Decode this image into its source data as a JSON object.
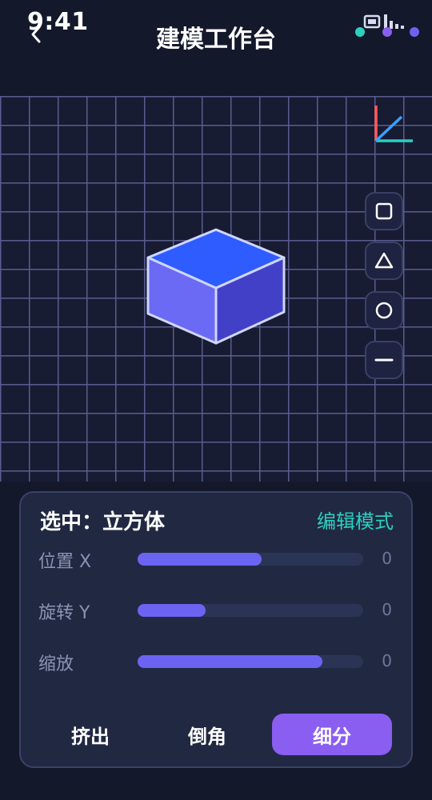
{
  "status_bar": {
    "time": "9:41"
  },
  "header": {
    "title": "建模工作台"
  },
  "panel": {
    "selection_label": "选中：立方体",
    "mode_label": "编辑模式",
    "params": [
      {
        "label": "位置 X",
        "value": "0",
        "level": 0.55
      },
      {
        "label": "旋转 Y",
        "value": "0",
        "level": 0.3
      },
      {
        "label": "缩放",
        "value": "0",
        "level": 0.82
      }
    ],
    "actions": [
      {
        "label": "挤出",
        "active": false
      },
      {
        "label": "倒角",
        "active": false
      },
      {
        "label": "细分",
        "active": true
      }
    ]
  },
  "tools": [
    {
      "icon": "square-icon"
    },
    {
      "icon": "triangle-icon"
    },
    {
      "icon": "circle-icon"
    },
    {
      "icon": "minus-icon"
    }
  ],
  "colors": {
    "accent_purple": "#8a5ef0",
    "slider_fill": "#6c63f2",
    "mode_teal": "#2bd0bf",
    "cube_top": "#2f5cff",
    "axis_x": "#ff5a5a",
    "axis_y": "#2bd0bf",
    "axis_z": "#3aa0ff"
  }
}
